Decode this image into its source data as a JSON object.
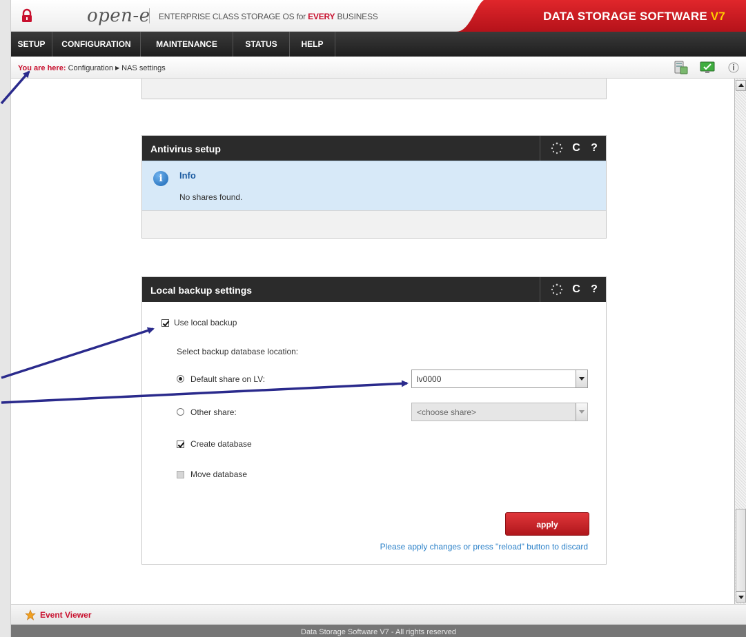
{
  "header": {
    "brand": "open-e",
    "tagline_prefix": "ENTERPRISE CLASS STORAGE OS for ",
    "tagline_highlight": "EVERY",
    "tagline_suffix": " BUSINESS",
    "product": "DATA STORAGE SOFTWARE ",
    "product_version": "V7"
  },
  "nav": {
    "items": [
      {
        "label": "SETUP"
      },
      {
        "label": "CONFIGURATION"
      },
      {
        "label": "MAINTENANCE"
      },
      {
        "label": "STATUS"
      },
      {
        "label": "HELP"
      }
    ]
  },
  "breadcrumb": {
    "prefix": "You are here:",
    "parts": [
      "Configuration",
      "NAS settings"
    ]
  },
  "antivirus": {
    "title": "Antivirus setup",
    "info_title": "Info",
    "info_text": "No shares found."
  },
  "local_backup": {
    "title": "Local backup settings",
    "use_local_backup_label": "Use local backup",
    "use_local_backup_checked": true,
    "select_location_label": "Select backup database location:",
    "default_share_label": "Default share on LV:",
    "default_share_selected": true,
    "default_share_value": "lv0000",
    "other_share_label": "Other share:",
    "other_share_value": "<choose share>",
    "create_database_label": "Create database",
    "create_database_checked": true,
    "move_database_label": "Move database",
    "move_database_checked": false,
    "apply_label": "apply",
    "apply_hint": "Please apply changes or press \"reload\" button to discard"
  },
  "panel_tools": {
    "reload_glyph": "C",
    "help_glyph": "?"
  },
  "bottom": {
    "event_viewer": "Event Viewer",
    "footer": "Data Storage Software V7 - All rights reserved"
  },
  "colors": {
    "accent_red": "#c8102e",
    "nav_dark": "#2b2b2b",
    "info_blue": "#d7e9f8",
    "annotation_arrow": "#2a2a8c"
  },
  "icons": {
    "header": "lock-icon",
    "toolbar": [
      "server-icon",
      "monitor-check-icon",
      "info-small-icon"
    ],
    "panel_tools": [
      "spinner-icon",
      "reload-icon",
      "help-icon"
    ],
    "event": "star-icon"
  }
}
